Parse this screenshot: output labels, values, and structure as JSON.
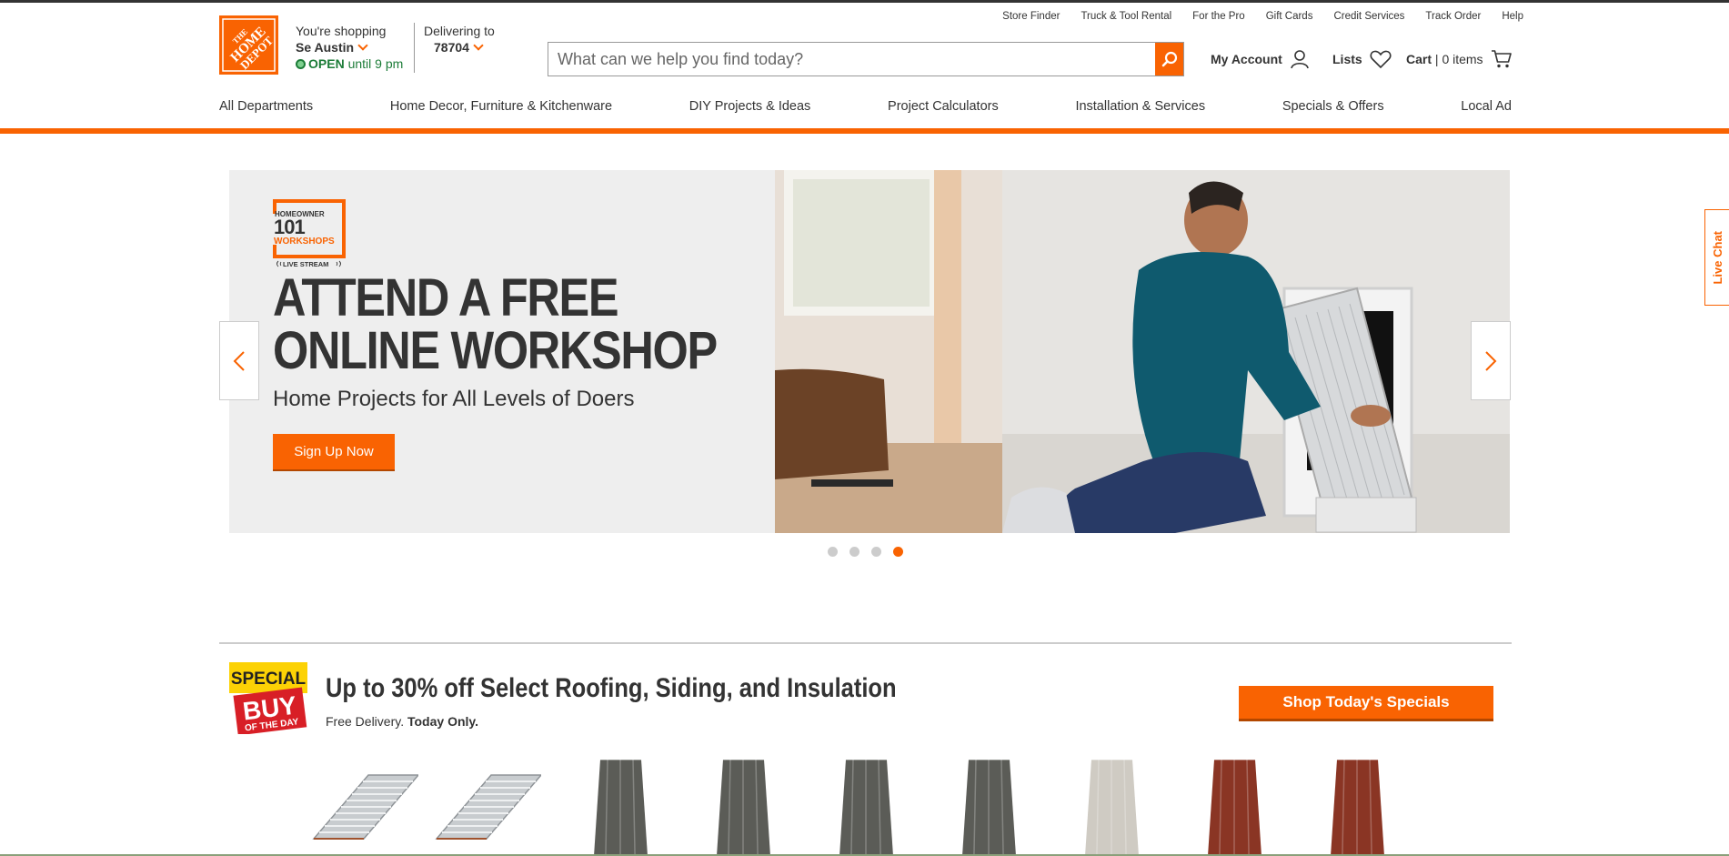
{
  "header": {
    "logo_text": "THE HOME DEPOT",
    "store": {
      "label": "You're shopping",
      "name": "Se Austin",
      "status": "OPEN",
      "hours": "until 9 pm"
    },
    "delivery": {
      "label": "Delivering to",
      "zip": "78704"
    },
    "utility_links": [
      "Store Finder",
      "Truck & Tool Rental",
      "For the Pro",
      "Gift Cards",
      "Credit Services",
      "Track Order",
      "Help"
    ],
    "search": {
      "placeholder": "What can we help you find today?"
    },
    "account_label": "My Account",
    "lists_label": "Lists",
    "cart_label": "Cart",
    "cart_sep": "|",
    "cart_count": "0 items"
  },
  "nav": {
    "items": [
      "All Departments",
      "Home Decor, Furniture & Kitchenware",
      "DIY Projects & Ideas",
      "Project Calculators",
      "Installation & Services",
      "Specials & Offers",
      "Local Ad"
    ]
  },
  "hero": {
    "badge": {
      "line1": "HOMEOWNER",
      "line2": "101",
      "line3": "WORKSHOPS",
      "line4": "LIVE STREAM"
    },
    "title_line1": "ATTEND A FREE",
    "title_line2": "ONLINE WORKSHOP",
    "subtitle": "Home Projects for All Levels of Doers",
    "cta": "Sign Up Now",
    "slide_count": 4,
    "active_slide": 4
  },
  "live_chat": "Live Chat",
  "special_buy": {
    "badge_line1": "SPECIAL",
    "badge_line2": "BUY",
    "badge_line3": "OF THE DAY",
    "title": "Up to 30% off Select Roofing, Siding, and Insulation",
    "sub_plain": "Free Delivery.",
    "sub_bold": "Today Only.",
    "cta": "Shop Today's Specials"
  },
  "products": [
    {
      "kind": "gutter-guard",
      "color": "#c8cccf"
    },
    {
      "kind": "gutter-guard",
      "color": "#c8cccf"
    },
    {
      "kind": "metal-panel",
      "color": "#5b5c57"
    },
    {
      "kind": "metal-panel",
      "color": "#5b5c57"
    },
    {
      "kind": "metal-panel",
      "color": "#5b5c57"
    },
    {
      "kind": "metal-panel",
      "color": "#5b5c57"
    },
    {
      "kind": "metal-panel",
      "color": "#cfcbc3"
    },
    {
      "kind": "metal-panel",
      "color": "#8a3524"
    },
    {
      "kind": "metal-panel",
      "color": "#8a3524"
    }
  ],
  "colors": {
    "brand_orange": "#f96302",
    "open_green": "#1c7c38",
    "text_dark": "#333333"
  }
}
